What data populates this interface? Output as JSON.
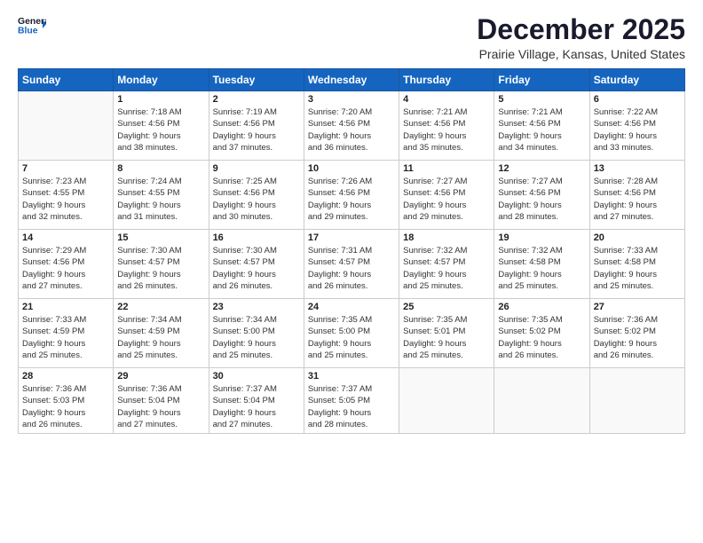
{
  "header": {
    "logo_line1": "General",
    "logo_line2": "Blue",
    "month": "December 2025",
    "location": "Prairie Village, Kansas, United States"
  },
  "weekdays": [
    "Sunday",
    "Monday",
    "Tuesday",
    "Wednesday",
    "Thursday",
    "Friday",
    "Saturday"
  ],
  "weeks": [
    [
      {
        "day": "",
        "info": ""
      },
      {
        "day": "1",
        "info": "Sunrise: 7:18 AM\nSunset: 4:56 PM\nDaylight: 9 hours\nand 38 minutes."
      },
      {
        "day": "2",
        "info": "Sunrise: 7:19 AM\nSunset: 4:56 PM\nDaylight: 9 hours\nand 37 minutes."
      },
      {
        "day": "3",
        "info": "Sunrise: 7:20 AM\nSunset: 4:56 PM\nDaylight: 9 hours\nand 36 minutes."
      },
      {
        "day": "4",
        "info": "Sunrise: 7:21 AM\nSunset: 4:56 PM\nDaylight: 9 hours\nand 35 minutes."
      },
      {
        "day": "5",
        "info": "Sunrise: 7:21 AM\nSunset: 4:56 PM\nDaylight: 9 hours\nand 34 minutes."
      },
      {
        "day": "6",
        "info": "Sunrise: 7:22 AM\nSunset: 4:56 PM\nDaylight: 9 hours\nand 33 minutes."
      }
    ],
    [
      {
        "day": "7",
        "info": "Sunrise: 7:23 AM\nSunset: 4:55 PM\nDaylight: 9 hours\nand 32 minutes."
      },
      {
        "day": "8",
        "info": "Sunrise: 7:24 AM\nSunset: 4:55 PM\nDaylight: 9 hours\nand 31 minutes."
      },
      {
        "day": "9",
        "info": "Sunrise: 7:25 AM\nSunset: 4:56 PM\nDaylight: 9 hours\nand 30 minutes."
      },
      {
        "day": "10",
        "info": "Sunrise: 7:26 AM\nSunset: 4:56 PM\nDaylight: 9 hours\nand 29 minutes."
      },
      {
        "day": "11",
        "info": "Sunrise: 7:27 AM\nSunset: 4:56 PM\nDaylight: 9 hours\nand 29 minutes."
      },
      {
        "day": "12",
        "info": "Sunrise: 7:27 AM\nSunset: 4:56 PM\nDaylight: 9 hours\nand 28 minutes."
      },
      {
        "day": "13",
        "info": "Sunrise: 7:28 AM\nSunset: 4:56 PM\nDaylight: 9 hours\nand 27 minutes."
      }
    ],
    [
      {
        "day": "14",
        "info": "Sunrise: 7:29 AM\nSunset: 4:56 PM\nDaylight: 9 hours\nand 27 minutes."
      },
      {
        "day": "15",
        "info": "Sunrise: 7:30 AM\nSunset: 4:57 PM\nDaylight: 9 hours\nand 26 minutes."
      },
      {
        "day": "16",
        "info": "Sunrise: 7:30 AM\nSunset: 4:57 PM\nDaylight: 9 hours\nand 26 minutes."
      },
      {
        "day": "17",
        "info": "Sunrise: 7:31 AM\nSunset: 4:57 PM\nDaylight: 9 hours\nand 26 minutes."
      },
      {
        "day": "18",
        "info": "Sunrise: 7:32 AM\nSunset: 4:57 PM\nDaylight: 9 hours\nand 25 minutes."
      },
      {
        "day": "19",
        "info": "Sunrise: 7:32 AM\nSunset: 4:58 PM\nDaylight: 9 hours\nand 25 minutes."
      },
      {
        "day": "20",
        "info": "Sunrise: 7:33 AM\nSunset: 4:58 PM\nDaylight: 9 hours\nand 25 minutes."
      }
    ],
    [
      {
        "day": "21",
        "info": "Sunrise: 7:33 AM\nSunset: 4:59 PM\nDaylight: 9 hours\nand 25 minutes."
      },
      {
        "day": "22",
        "info": "Sunrise: 7:34 AM\nSunset: 4:59 PM\nDaylight: 9 hours\nand 25 minutes."
      },
      {
        "day": "23",
        "info": "Sunrise: 7:34 AM\nSunset: 5:00 PM\nDaylight: 9 hours\nand 25 minutes."
      },
      {
        "day": "24",
        "info": "Sunrise: 7:35 AM\nSunset: 5:00 PM\nDaylight: 9 hours\nand 25 minutes."
      },
      {
        "day": "25",
        "info": "Sunrise: 7:35 AM\nSunset: 5:01 PM\nDaylight: 9 hours\nand 25 minutes."
      },
      {
        "day": "26",
        "info": "Sunrise: 7:35 AM\nSunset: 5:02 PM\nDaylight: 9 hours\nand 26 minutes."
      },
      {
        "day": "27",
        "info": "Sunrise: 7:36 AM\nSunset: 5:02 PM\nDaylight: 9 hours\nand 26 minutes."
      }
    ],
    [
      {
        "day": "28",
        "info": "Sunrise: 7:36 AM\nSunset: 5:03 PM\nDaylight: 9 hours\nand 26 minutes."
      },
      {
        "day": "29",
        "info": "Sunrise: 7:36 AM\nSunset: 5:04 PM\nDaylight: 9 hours\nand 27 minutes."
      },
      {
        "day": "30",
        "info": "Sunrise: 7:37 AM\nSunset: 5:04 PM\nDaylight: 9 hours\nand 27 minutes."
      },
      {
        "day": "31",
        "info": "Sunrise: 7:37 AM\nSunset: 5:05 PM\nDaylight: 9 hours\nand 28 minutes."
      },
      {
        "day": "",
        "info": ""
      },
      {
        "day": "",
        "info": ""
      },
      {
        "day": "",
        "info": ""
      }
    ]
  ]
}
